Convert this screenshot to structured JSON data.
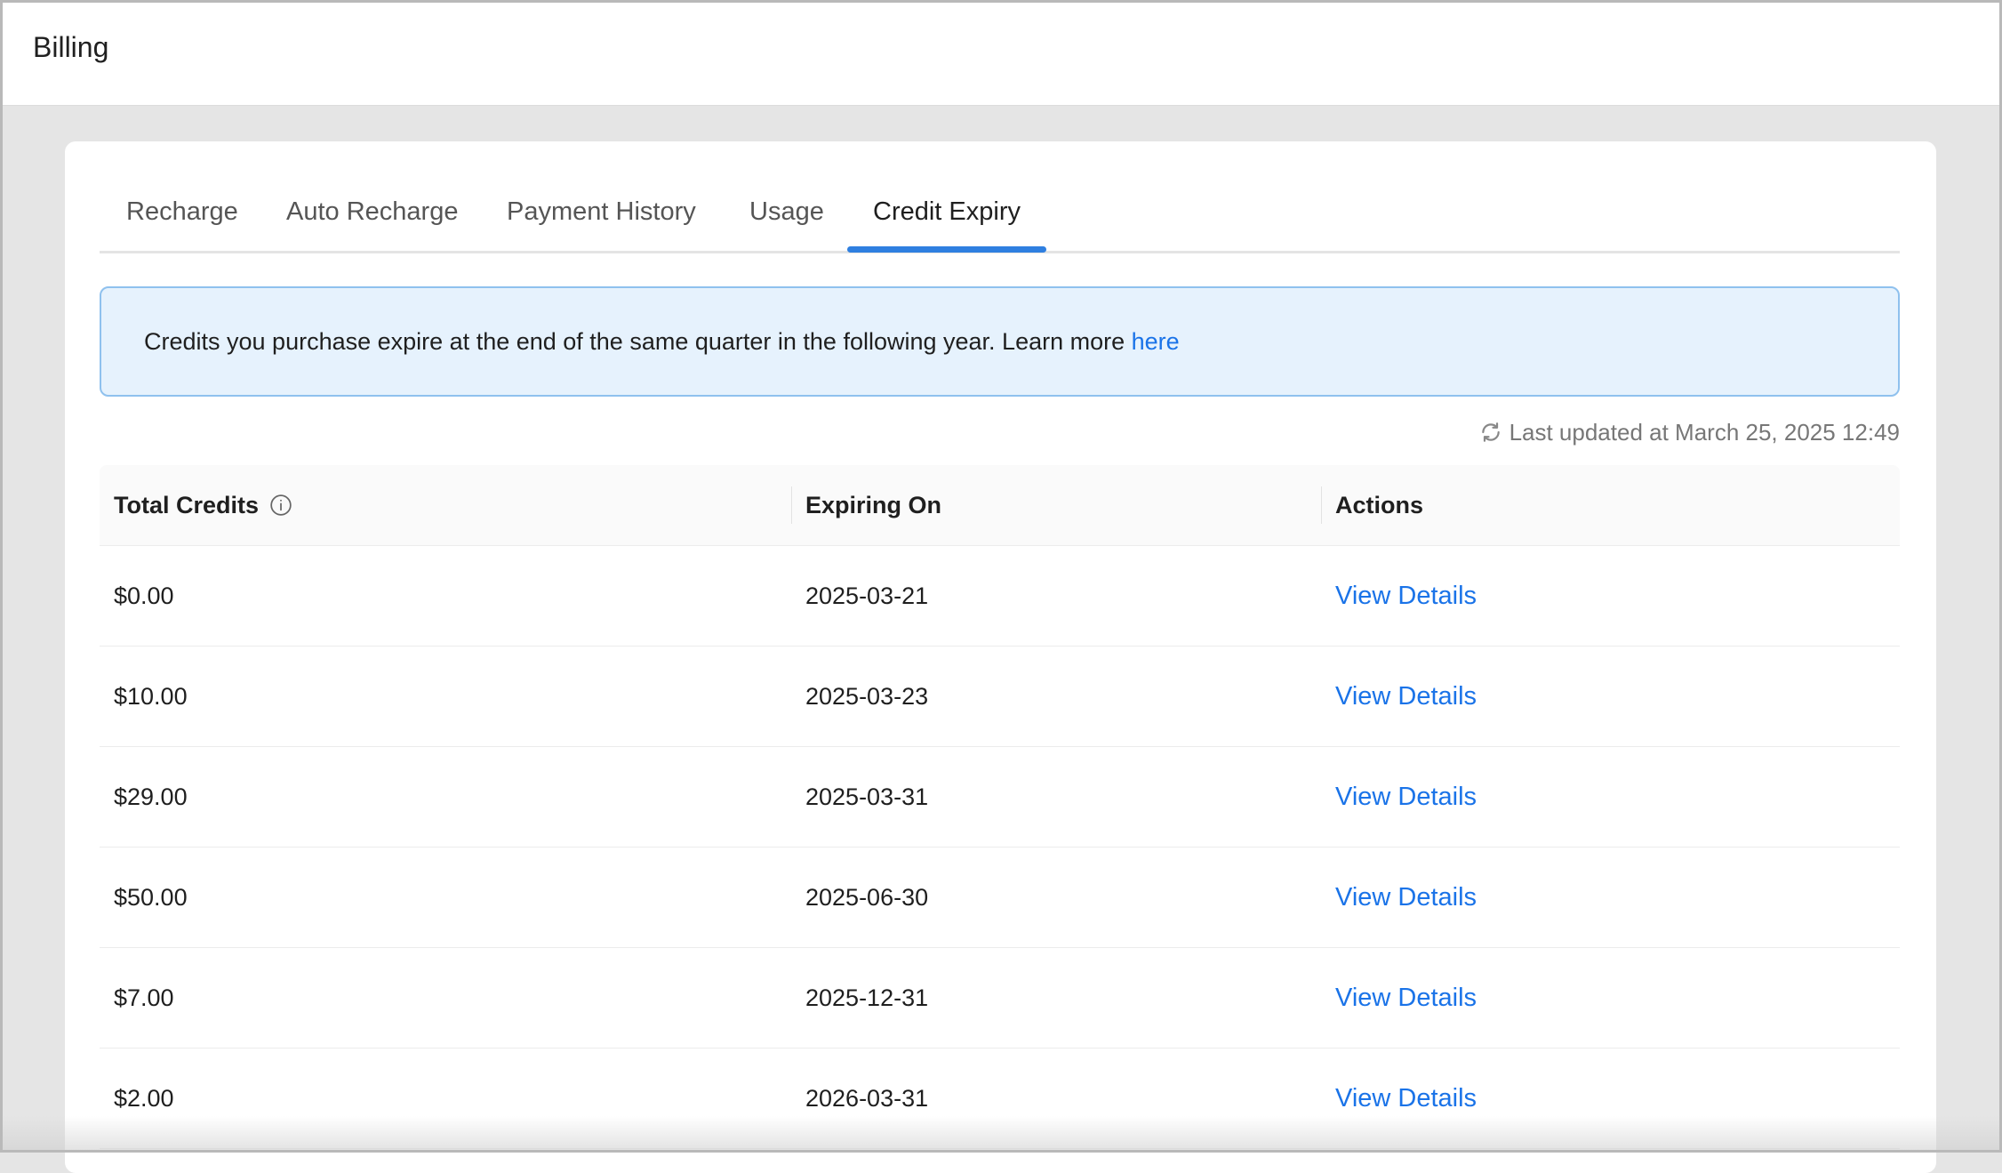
{
  "header": {
    "title": "Billing"
  },
  "tabs": [
    {
      "label": "Recharge",
      "active": false
    },
    {
      "label": "Auto Recharge",
      "active": false
    },
    {
      "label": "Payment History",
      "active": false
    },
    {
      "label": "Usage",
      "active": false
    },
    {
      "label": "Credit Expiry",
      "active": true
    }
  ],
  "notice": {
    "text": "Credits you purchase expire at the end of the same quarter in the following year. Learn more ",
    "link_label": "here"
  },
  "last_updated": {
    "icon": "refresh-icon",
    "text": "Last updated at March 25, 2025 12:49"
  },
  "table": {
    "columns": [
      "Total Credits",
      "Expiring On",
      "Actions"
    ],
    "header_icon": "info-icon",
    "rows": [
      {
        "credits": "$0.00",
        "expiring_on": "2025-03-21",
        "action": "View Details"
      },
      {
        "credits": "$10.00",
        "expiring_on": "2025-03-23",
        "action": "View Details"
      },
      {
        "credits": "$29.00",
        "expiring_on": "2025-03-31",
        "action": "View Details"
      },
      {
        "credits": "$50.00",
        "expiring_on": "2025-06-30",
        "action": "View Details"
      },
      {
        "credits": "$7.00",
        "expiring_on": "2025-12-31",
        "action": "View Details"
      },
      {
        "credits": "$2.00",
        "expiring_on": "2026-03-31",
        "action": "View Details"
      }
    ]
  },
  "colors": {
    "accent": "#2f7fe0",
    "link": "#1a73e8",
    "notice_bg": "#e6f2fd",
    "notice_border": "#8fc1ee"
  }
}
